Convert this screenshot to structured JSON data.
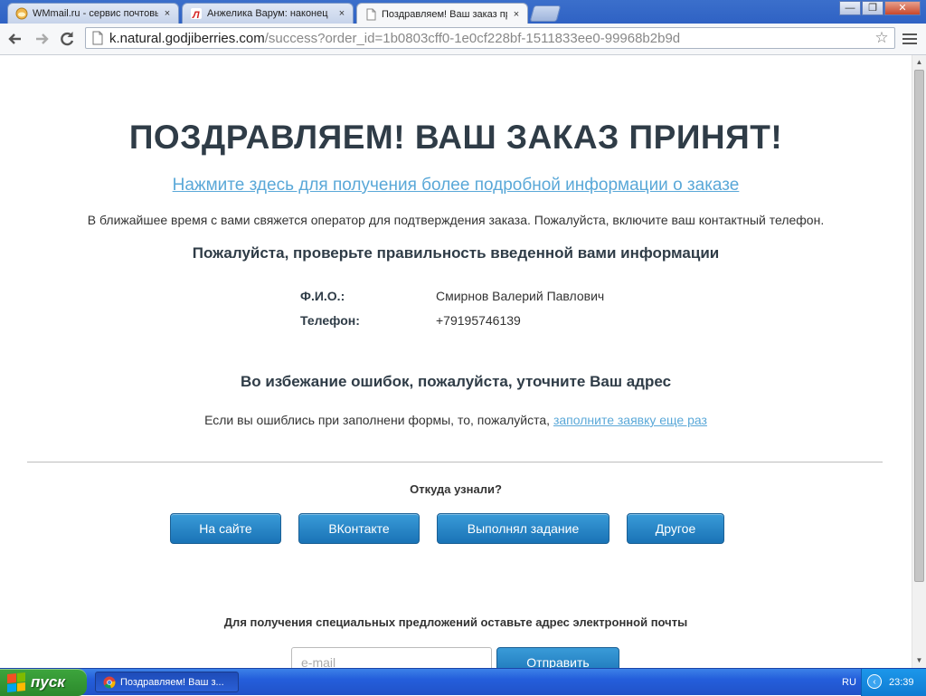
{
  "browser": {
    "tabs": [
      {
        "title": "WMmail.ru - сервис почтовых",
        "favicon": "wmmail-favicon",
        "active": false
      },
      {
        "title": "Анжелика Варум: наконец",
        "favicon": "lenta-favicon",
        "active": false
      },
      {
        "title": "Поздравляем! Ваш заказ пр",
        "favicon": "page-favicon",
        "active": true
      }
    ],
    "close_glyph": "×",
    "url_host": "k.natural.godjiberries.com",
    "url_rest": "/success?order_id=1b0803cff0-1e0cf228bf-1511833ee0-99968b2b9d",
    "window_buttons": {
      "minimize": "—",
      "maximize": "❐",
      "close": "✕"
    }
  },
  "page": {
    "headline": "ПОЗДРАВЛЯЕМ! ВАШ ЗАКАЗ ПРИНЯТ!",
    "details_link": "Нажмите здесь для получения более подробной информации о заказе",
    "notice": "В ближайшее время с вами свяжется оператор для подтверждения заказа. Пожалуйста, включите ваш контактный телефон.",
    "check_heading": "Пожалуйста, проверьте правильность введенной вами информации",
    "info": [
      {
        "label": "Ф.И.О.:",
        "value": "Смирнов Валерий Павлович"
      },
      {
        "label": "Телефон:",
        "value": "+79195746139"
      }
    ],
    "address_heading": "Во избежание ошибок, пожалуйста, уточните Ваш адрес",
    "retry_text": "Если вы ошиблись при заполнени формы, то, пожалуйста,",
    "retry_link": "заполните заявку еще раз",
    "source_question": "Откуда узнали?",
    "source_buttons": [
      "На сайте",
      "ВКонтакте",
      "Выполнял задание",
      "Другое"
    ],
    "email_prompt": "Для получения специальных предложений оставьте адрес электронной почты",
    "email_placeholder": "e-mail",
    "send_button": "Отправить"
  },
  "taskbar": {
    "start_label": "пуск",
    "task_item": "Поздравляем! Ваш з...",
    "language": "RU",
    "clock": "23:39"
  },
  "colors": {
    "accent_link": "#5aa8d8",
    "button_blue": "#1a73b6",
    "heading": "#2f3c47"
  }
}
